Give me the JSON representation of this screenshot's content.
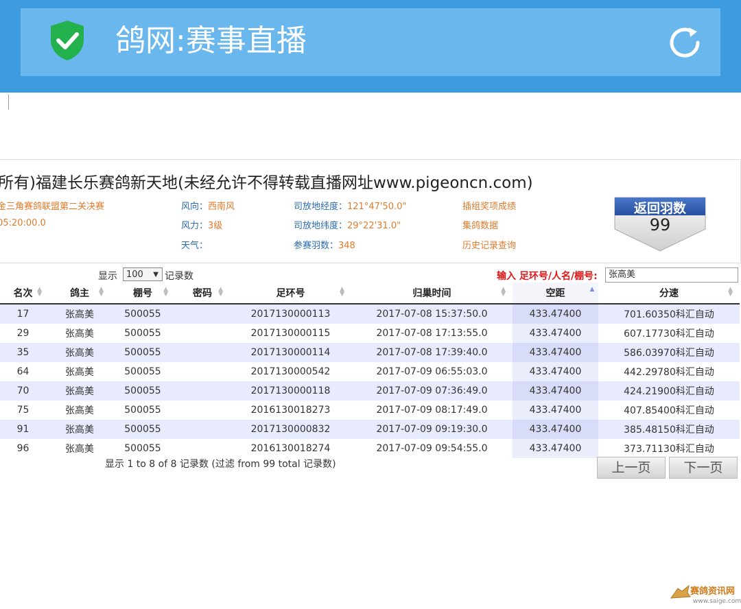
{
  "app": {
    "title": "鸽网:赛事直播"
  },
  "race": {
    "title": "所有)福建长乐赛鸽新天地(未经允许不得转载直播网址www.pigeoncn.com)",
    "name": "金三角赛鸽联盟第二关决赛",
    "release_time": "05:20:00.0",
    "wind_dir_label": "风向：",
    "wind_dir": "西南风",
    "wind_force_label": "风力：",
    "wind_force": "3级",
    "weather_label": "天气：",
    "weather": "",
    "lon_label": "司放地经度：",
    "lon": "121°47'50.0\"",
    "lat_label": "司放地纬度：",
    "lat": "29°22'31.0\"",
    "count_label": "参赛羽数：",
    "count": "348",
    "link1": "插组奖项成绩",
    "link2": "集鸽数据",
    "link3": "历史记录查询",
    "return_label": "返回羽数",
    "return_count": "99"
  },
  "controls": {
    "show_label": "显示",
    "page_size": "100",
    "records_label": "记录数",
    "search_label": "输入 足环号/人名/棚号:",
    "search_value": "张高美"
  },
  "table": {
    "headers": [
      "名次",
      "鸽主",
      "棚号",
      "密码",
      "足环号",
      "归巢时间",
      "空距",
      "分速"
    ],
    "rows": [
      [
        "17",
        "张高美",
        "500055",
        "",
        "2017130000113",
        "2017-07-08 15:37:50.0",
        "433.47400",
        "701.60350科汇自动"
      ],
      [
        "29",
        "张高美",
        "500055",
        "",
        "2017130000115",
        "2017-07-08 17:13:55.0",
        "433.47400",
        "607.17730科汇自动"
      ],
      [
        "35",
        "张高美",
        "500055",
        "",
        "2017130000114",
        "2017-07-08 17:39:40.0",
        "433.47400",
        "586.03970科汇自动"
      ],
      [
        "64",
        "张高美",
        "500055",
        "",
        "2017130000542",
        "2017-07-09 06:55:03.0",
        "433.47400",
        "442.29780科汇自动"
      ],
      [
        "70",
        "张高美",
        "500055",
        "",
        "2017130000118",
        "2017-07-09 07:36:49.0",
        "433.47400",
        "424.21900科汇自动"
      ],
      [
        "75",
        "张高美",
        "500055",
        "",
        "2016130018273",
        "2017-07-09 08:17:49.0",
        "433.47400",
        "407.85400科汇自动"
      ],
      [
        "91",
        "张高美",
        "500055",
        "",
        "2017130000832",
        "2017-07-09 09:19:30.0",
        "433.47400",
        "385.48150科汇自动"
      ],
      [
        "96",
        "张高美",
        "500055",
        "",
        "2016130018274",
        "2017-07-09 09:54:55.0",
        "433.47400",
        "373.71130科汇自动"
      ]
    ],
    "info": "显示 1 to 8 of 8 记录数 (过滤 from 99 total 记录数)"
  },
  "pagination": {
    "prev": "上一页",
    "next": "下一页"
  },
  "watermark": {
    "title": "赛鸽资讯网",
    "url": "www.saige.com"
  },
  "colors": {
    "header_bar": "#3d9be0",
    "title_bar": "#6ab7ee",
    "odd_row": "#e8ebfd",
    "label": "#2a6ab0",
    "value": "#e07a2a",
    "search_label": "#e01818"
  }
}
